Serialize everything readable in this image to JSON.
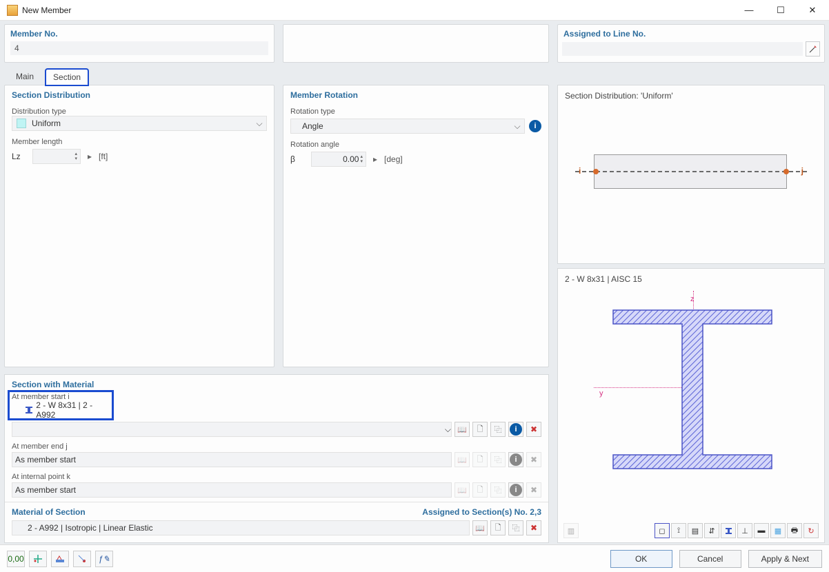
{
  "window": {
    "title": "New Member"
  },
  "top": {
    "member_no_label": "Member No.",
    "member_no_value": "4",
    "assigned_label": "Assigned to Line No.",
    "assigned_value": ""
  },
  "tabs": {
    "main": "Main",
    "section": "Section"
  },
  "section_distribution": {
    "header": "Section Distribution",
    "dist_type_label": "Distribution type",
    "dist_type_value": "Uniform",
    "member_length_label": "Member length",
    "lz_label": "Lz",
    "lz_unit": "[ft]"
  },
  "member_rotation": {
    "header": "Member Rotation",
    "rot_type_label": "Rotation type",
    "rot_type_value": "Angle",
    "rot_angle_label": "Rotation angle",
    "beta": "β",
    "beta_value": "0.00",
    "beta_unit": "[deg]"
  },
  "section_with_material": {
    "header": "Section with Material",
    "start_label": "At member start i",
    "start_value": "2 - W 8x31 | 2 - A992",
    "end_label": "At member end j",
    "end_value": "As member start",
    "internal_label": "At internal point k",
    "internal_value": "As member start"
  },
  "material_of_section": {
    "header": "Material of Section",
    "assigned": "Assigned to Section(s) No. 2,3",
    "value": "2 - A992 | Isotropic | Linear Elastic"
  },
  "preview": {
    "dist_title": "Section Distribution: 'Uniform'",
    "i": "i",
    "j": "j",
    "section_title": "2 - W 8x31 | AISC 15",
    "z": "z",
    "y": "y"
  },
  "footer": {
    "ok": "OK",
    "cancel": "Cancel",
    "apply": "Apply & Next"
  }
}
